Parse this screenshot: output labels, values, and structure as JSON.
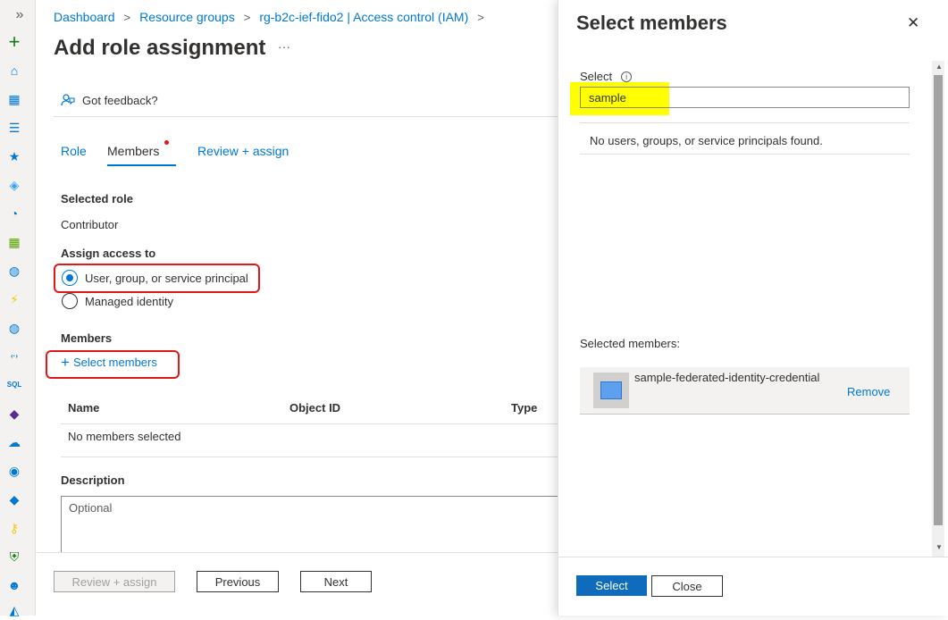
{
  "rail": {
    "collapse_glyph": "»",
    "items": [
      {
        "name": "create-icon",
        "glyph": "+",
        "color": "#107c10"
      },
      {
        "name": "home-icon",
        "glyph": "⌂",
        "color": "#0078d4"
      },
      {
        "name": "dashboard-icon",
        "glyph": "▦",
        "color": "#0078d4"
      },
      {
        "name": "all-services-icon",
        "glyph": "☰",
        "color": "#0078d4"
      },
      {
        "name": "favorites-star-icon",
        "glyph": "★",
        "color": "#0078d4"
      },
      {
        "name": "resource-groups-icon",
        "glyph": "◈",
        "color": "#3aa0ff"
      },
      {
        "name": "speedometer-icon",
        "glyph": "◔",
        "color": "#0078d4"
      },
      {
        "name": "all-resources-grid-icon",
        "glyph": "▦",
        "color": "#57a300"
      },
      {
        "name": "globe-icon",
        "glyph": "◍",
        "color": "#0078d4"
      },
      {
        "name": "function-icon",
        "glyph": "⚡",
        "color": "#f2c811"
      },
      {
        "name": "network-globe-icon",
        "glyph": "◍",
        "color": "#0078d4"
      },
      {
        "name": "load-balancer-icon",
        "glyph": "‹·›",
        "color": "#0078d4"
      },
      {
        "name": "sql-icon",
        "glyph": "SQL",
        "color": "#0078d4"
      },
      {
        "name": "cosmos-icon",
        "glyph": "◆",
        "color": "#5c2d91"
      },
      {
        "name": "cloud-service-icon",
        "glyph": "☁",
        "color": "#0078d4"
      },
      {
        "name": "monitor-icon",
        "glyph": "◉",
        "color": "#0078d4"
      },
      {
        "name": "devops-icon",
        "glyph": "◆",
        "color": "#0078d4"
      },
      {
        "name": "key-icon",
        "glyph": "⚷",
        "color": "#f2c811"
      },
      {
        "name": "security-shield-icon",
        "glyph": "⛨",
        "color": "#107c10"
      },
      {
        "name": "user-icon",
        "glyph": "☻",
        "color": "#0078d4"
      },
      {
        "name": "advisor-icon",
        "glyph": "◭",
        "color": "#0078d4"
      }
    ]
  },
  "breadcrumb": {
    "items": [
      "Dashboard",
      "Resource groups",
      "rg-b2c-ief-fido2 | Access control (IAM)"
    ],
    "separator": ">"
  },
  "page": {
    "title": "Add role assignment",
    "more_glyph": "···",
    "feedback": "Got feedback?"
  },
  "tabs": [
    "Role",
    "Members",
    "Review + assign"
  ],
  "form": {
    "selected_role_label": "Selected role",
    "selected_role_value": "Contributor",
    "assign_access_label": "Assign access to",
    "option_user": "User, group, or service principal",
    "option_managed": "Managed identity",
    "members_label": "Members",
    "select_members_plus": "+",
    "select_members_link": "Select members",
    "table_headers": [
      "Name",
      "Object ID",
      "Type"
    ],
    "table_empty": "No members selected",
    "description_label": "Description",
    "description_placeholder": "Optional"
  },
  "footer": {
    "review_assign": "Review + assign",
    "previous": "Previous",
    "next": "Next"
  },
  "panel": {
    "title": "Select members",
    "close_glyph": "✕",
    "select_label": "Select",
    "info_glyph": "i",
    "search_value": "sample",
    "no_results": "No users, groups, or service principals found.",
    "selected_members_label": "Selected members:",
    "selected_member_name": "sample-federated-identity-credential",
    "remove": "Remove",
    "select_button": "Select",
    "close_button": "Close"
  },
  "colors": {
    "accent": "#0078d4",
    "highlight": "#ffff00",
    "annotation_red": "#e31717",
    "required_dot": "#e31717"
  }
}
